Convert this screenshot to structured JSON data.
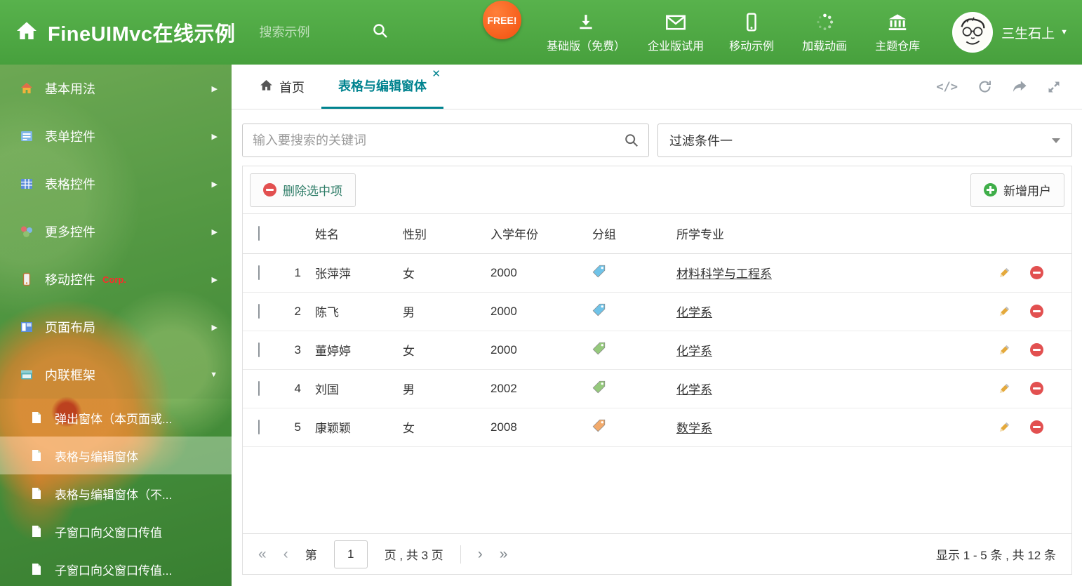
{
  "header": {
    "title": "FineUIMvc在线示例",
    "search_placeholder": "搜索示例",
    "free_badge": "FREE!",
    "nav": [
      {
        "label": "基础版（免费）",
        "icon": "download-icon"
      },
      {
        "label": "企业版试用",
        "icon": "envelope-icon"
      },
      {
        "label": "移动示例",
        "icon": "mobile-icon"
      },
      {
        "label": "加载动画",
        "icon": "spinner-icon"
      },
      {
        "label": "主题仓库",
        "icon": "bank-icon"
      }
    ],
    "user_name": "三生石上"
  },
  "sidebar": {
    "items": [
      {
        "label": "基本用法",
        "icon": "home-icon"
      },
      {
        "label": "表单控件",
        "icon": "form-icon"
      },
      {
        "label": "表格控件",
        "icon": "table-icon"
      },
      {
        "label": "更多控件",
        "icon": "widgets-icon"
      },
      {
        "label": "移动控件",
        "icon": "mobile-icon",
        "badge": "Corp."
      },
      {
        "label": "页面布局",
        "icon": "layout-icon"
      },
      {
        "label": "内联框架",
        "icon": "frame-icon",
        "expanded": true
      }
    ],
    "children": [
      {
        "label": "弹出窗体（本页面或..."
      },
      {
        "label": "表格与编辑窗体",
        "selected": true
      },
      {
        "label": "表格与编辑窗体（不..."
      },
      {
        "label": "子窗口向父窗口传值"
      },
      {
        "label": "子窗口向父窗口传值..."
      }
    ]
  },
  "tabs": [
    {
      "label": "首页"
    },
    {
      "label": "表格与编辑窗体",
      "active": true,
      "closable": true
    }
  ],
  "filter": {
    "search_placeholder": "输入要搜索的关键词",
    "dropdown_value": "过滤条件一"
  },
  "toolbar": {
    "delete_label": "删除选中项",
    "add_label": "新增用户"
  },
  "table": {
    "columns": [
      "姓名",
      "性别",
      "入学年份",
      "分组",
      "所学专业"
    ],
    "rows": [
      {
        "num": "1",
        "name": "张萍萍",
        "gender": "女",
        "year": "2000",
        "tag_color": "#6fc3e8",
        "major": "材料科学与工程系"
      },
      {
        "num": "2",
        "name": "陈飞",
        "gender": "男",
        "year": "2000",
        "tag_color": "#6fc3e8",
        "major": "化学系"
      },
      {
        "num": "3",
        "name": "董婷婷",
        "gender": "女",
        "year": "2000",
        "tag_color": "#95c97c",
        "major": "化学系"
      },
      {
        "num": "4",
        "name": "刘国",
        "gender": "男",
        "year": "2002",
        "tag_color": "#95c97c",
        "major": "化学系"
      },
      {
        "num": "5",
        "name": "康颖颖",
        "gender": "女",
        "year": "2008",
        "tag_color": "#f2aa6b",
        "major": "数学系"
      }
    ]
  },
  "pagination": {
    "page_prefix": "第",
    "page_value": "1",
    "page_suffix": "页 , 共 3 页",
    "summary": "显示 1 - 5 条 , 共 12 条"
  },
  "colors": {
    "header_green": "#4ea443",
    "accent_teal": "#00838f",
    "delete_red": "#e25050",
    "add_green": "#3fae49",
    "pencil_orange": "#e4a93c"
  }
}
